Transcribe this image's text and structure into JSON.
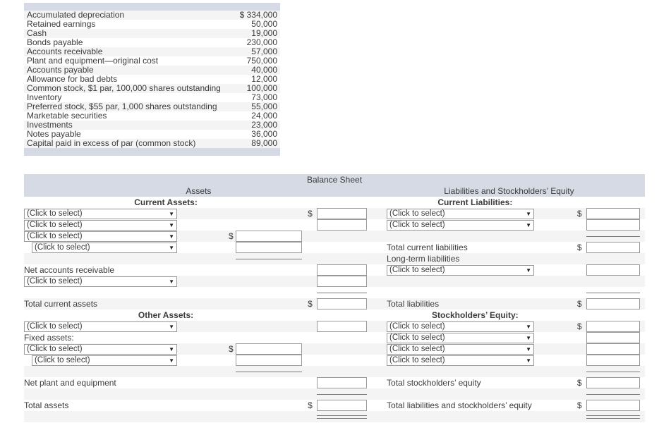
{
  "accounts_table": {
    "columns": [
      "account",
      "amount"
    ],
    "rows": [
      {
        "account": "Accumulated depreciation",
        "amount": "$ 334,000"
      },
      {
        "account": "Retained earnings",
        "amount": "50,000"
      },
      {
        "account": "Cash",
        "amount": "19,000"
      },
      {
        "account": "Bonds payable",
        "amount": "230,000"
      },
      {
        "account": "Accounts receivable",
        "amount": "57,000"
      },
      {
        "account": "Plant and equipment—original cost",
        "amount": "750,000"
      },
      {
        "account": "Accounts payable",
        "amount": "40,000"
      },
      {
        "account": "Allowance for bad debts",
        "amount": "12,000"
      },
      {
        "account": "Common stock, $1 par, 100,000 shares outstanding",
        "amount": "100,000"
      },
      {
        "account": "Inventory",
        "amount": "73,000"
      },
      {
        "account": "Preferred stock, $55 par, 1,000 shares outstanding",
        "amount": "55,000"
      },
      {
        "account": "Marketable securities",
        "amount": "24,000"
      },
      {
        "account": "Investments",
        "amount": "23,000"
      },
      {
        "account": "Notes payable",
        "amount": "36,000"
      },
      {
        "account": "Capital paid in excess of par (common stock)",
        "amount": "89,000"
      }
    ]
  },
  "balance_sheet": {
    "title": "Balance Sheet",
    "assets_heading": "Assets",
    "liabilities_heading": "Liabilities and Stockholders’ Equity",
    "select_placeholder": "(Click to select)",
    "dropdown_arrow": "▼",
    "dollar_sign": "$",
    "left": {
      "current_assets_heading": "Current Assets:",
      "net_accounts_receivable": "Net accounts receivable",
      "total_current_assets": "Total current assets",
      "other_assets_heading": "Other Assets:",
      "fixed_assets_label": "Fixed assets:",
      "net_plant_and_equipment": "Net plant and equipment",
      "total_assets": "Total assets"
    },
    "right": {
      "current_liabilities_heading": "Current Liabilities:",
      "total_current_liabilities": "Total current liabilities",
      "long_term_liabilities_label": "Long-term liabilities",
      "total_liabilities": "Total liabilities",
      "stockholders_equity_heading": "Stockholders’ Equity:",
      "total_stockholders_equity": "Total stockholders’ equity",
      "total_liab_and_equity": "Total liabilities and stockholders’ equity"
    },
    "input_value": ""
  },
  "colors": {
    "band": "#d5dae4",
    "row_alt": "#f4f4f4",
    "text": "#3b3b3b",
    "border": "#9a9a9a",
    "rule": "#7a7a7a"
  }
}
